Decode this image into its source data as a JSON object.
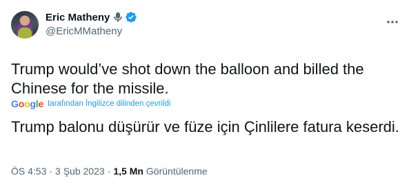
{
  "author": {
    "display_name": "Eric Matheny",
    "handle": "@EricMMatheny",
    "avatar_icon": "profile-photo",
    "badges": [
      "microphone-icon",
      "verified-checkmark-icon"
    ],
    "verified_color": "#1d9bf0"
  },
  "tweet": {
    "text": "Trump would’ve shot down the balloon and billed the Chinese for the missile.",
    "translation": {
      "provider": "Google",
      "label": "tarafından İngilizce dilinden çevrildi",
      "text": "Trump balonu düşürür ve füze için Çinlilere fatura keserdi."
    }
  },
  "meta": {
    "time": "ÖS 4:53",
    "separator": "·",
    "date": "3 Şub 2023",
    "views_count": "1,5 Mn",
    "views_label": "Görüntülenme"
  },
  "colors": {
    "text_primary": "#0f1419",
    "text_secondary": "#536471",
    "link": "#1d9bf0"
  }
}
